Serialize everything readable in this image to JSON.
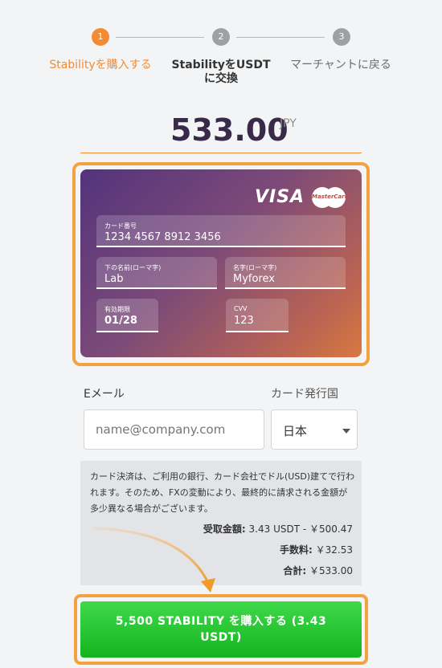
{
  "steps": [
    {
      "number": "1",
      "label": "Stabilityを購入する"
    },
    {
      "number": "2",
      "label": "StabilityをUSDTに交換"
    },
    {
      "number": "3",
      "label": "マーチャントに戻る"
    }
  ],
  "amount": {
    "value": "533.00",
    "currency": "JPY"
  },
  "card": {
    "brand_visa": "VISA",
    "brand_mastercard": "MasterCard",
    "number_label": "カード番号",
    "number_value": "1234 4567 8912 3456",
    "last_name_label": "下の名前(ローマ字)",
    "last_name_value": "Lab",
    "first_name_label": "名字(ローマ字)",
    "first_name_value": "Myforex",
    "expiry_label": "有効期限",
    "expiry_value": "01/28",
    "cvv_label": "CVV",
    "cvv_value": "123"
  },
  "form": {
    "email_label": "Eメール",
    "email_placeholder": "name@company.com",
    "country_label": "カード発行国",
    "country_value": "日本"
  },
  "info": {
    "notice": "カード決済は、ご利用の銀行、カード会社でドル(USD)建てで行われます。そのため、FXの変動により、最終的に請求される金額が多少異なる場合がございます。",
    "received_label": "受取金額:",
    "received_value": "3.43 USDT - ￥500.47",
    "fee_label": "手数料:",
    "fee_value": "￥32.53",
    "total_label": "合計:",
    "total_value": "￥533.00"
  },
  "buy_button_label": "5,500 STABILITY を購入する (3.43 USDT)",
  "colors": {
    "accent": "#f28c34",
    "button": "#22c42c",
    "frame": "#f2a23e"
  }
}
